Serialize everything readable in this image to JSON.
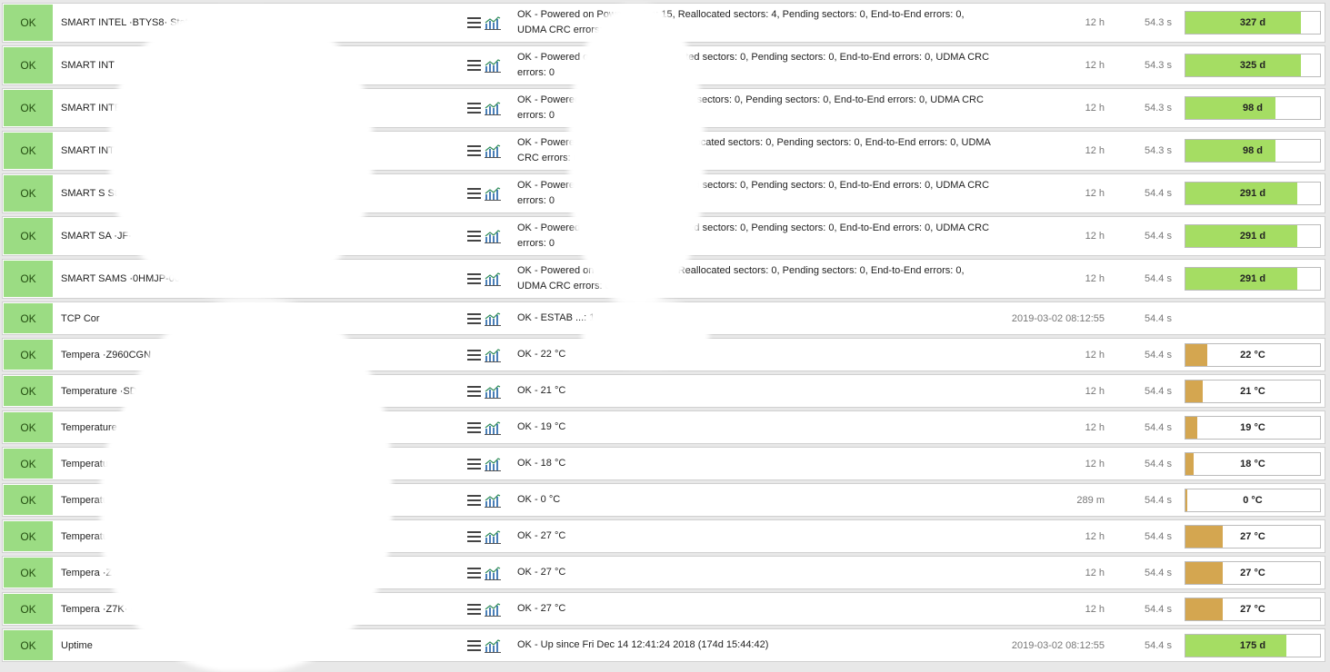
{
  "colors": {
    "ok": "#9bdc83",
    "perf_green": "#a5dd63",
    "perf_temp": "#d4a650"
  },
  "rows": [
    {
      "state": "OK",
      "service": "SMART INTEL ·BTYS8· Stats",
      "output": "OK - Powered on Power cycles: 15, Reallocated sectors: 4, Pending sectors: 0, End-to-End errors: 0, UDMA CRC errors: 0",
      "age": "12 h",
      "duration": "54.3 s",
      "perf": "327 d",
      "perf_pct": 0.86,
      "perf_kind": "green"
    },
    {
      "state": "OK",
      "service": "SMART INT",
      "output": "OK - Powered on cycles: 20, Reallocated sectors: 0, Pending sectors: 0, End-to-End errors: 0, UDMA CRC errors: 0",
      "age": "12 h",
      "duration": "54.3 s",
      "perf": "325 d",
      "perf_pct": 0.86,
      "perf_kind": "green"
    },
    {
      "state": "OK",
      "service": "SMART INTE Stats",
      "output": "OK - Powered on cycles: 4, Reallocated sectors: 0, Pending sectors: 0, End-to-End errors: 0, UDMA CRC errors: 0",
      "age": "12 h",
      "duration": "54.3 s",
      "perf": "98 d",
      "perf_pct": 0.67,
      "perf_kind": "green"
    },
    {
      "state": "OK",
      "service": "SMART INTE ·8_PHY· Stats",
      "output": "OK - Powered on Power cycles: 4, Reallocated sectors: 0, Pending sectors: 0, End-to-End errors: 0, UDMA CRC errors: 0",
      "age": "12 h",
      "duration": "54.3 s",
      "perf": "98 d",
      "perf_pct": 0.67,
      "perf_kind": "green"
    },
    {
      "state": "OK",
      "service": "SMART S Stats",
      "output": "OK - Powered on cycles: 55, Reallocated sectors: 0, Pending sectors: 0, End-to-End errors: 0, UDMA CRC errors: 0",
      "age": "12 h",
      "duration": "54.4 s",
      "perf": "291 d",
      "perf_pct": 0.83,
      "perf_kind": "green"
    },
    {
      "state": "OK",
      "service": "SMART SA ·JF· 74 Stats",
      "output": "OK - Powered on cycles: 55, Reallocated sectors: 0, Pending sectors: 0, End-to-End errors: 0, UDMA CRC errors: 0",
      "age": "12 h",
      "duration": "54.4 s",
      "perf": "291 d",
      "perf_pct": 0.83,
      "perf_kind": "green"
    },
    {
      "state": "OK",
      "service": "SMART SAMS ·0HMJP-00· 00976 Stats",
      "output": "OK - Powered on Power cycles: 55, Reallocated sectors: 0, Pending sectors: 0, End-to-End errors: 0, UDMA CRC errors: 0",
      "age": "12 h",
      "duration": "54.4 s",
      "perf": "291 d",
      "perf_pct": 0.83,
      "perf_kind": "green"
    },
    {
      "state": "OK",
      "service": "TCP Cor",
      "output": "OK - ESTAB ...: 1, LISTEN: 34",
      "age": "2019-03-02 08:12:55",
      "duration": "54.4 s",
      "perf": "",
      "perf_pct": 0,
      "perf_kind": "none"
    },
    {
      "state": "OK",
      "service": "Tempera ·Z960CGN",
      "output": "OK - 22 °C",
      "age": "12 h",
      "duration": "54.4 s",
      "perf": "22 °C",
      "perf_pct": 0.16,
      "perf_kind": "temp"
    },
    {
      "state": "OK",
      "service": "Temperature ·SDSC2KB· 60E1X960CGN",
      "output": "OK - 21 °C",
      "age": "12 h",
      "duration": "54.4 s",
      "perf": "21 °C",
      "perf_pct": 0.13,
      "perf_kind": "temp"
    },
    {
      "state": "OK",
      "service": "Temperature ·2KB9· 960CGN",
      "output": "OK - 19 °C",
      "age": "12 h",
      "duration": "54.4 s",
      "perf": "19 °C",
      "perf_pct": 0.09,
      "perf_kind": "temp"
    },
    {
      "state": "OK",
      "service": "Temperatur ·0CGN",
      "output": "OK - 18 °C",
      "age": "12 h",
      "duration": "54.4 s",
      "perf": "18 °C",
      "perf_pct": 0.06,
      "perf_kind": "temp"
    },
    {
      "state": "OK",
      "service": "Temperature ·ume_",
      "output": "OK - 0 °C",
      "age": "289 m",
      "duration": "54.4 s",
      "perf": "0 °C",
      "perf_pct": 0.01,
      "perf_kind": "temp"
    },
    {
      "state": "OK",
      "service": "Temperature ·G_MZ7KM960H· 2E3NX0K600972",
      "output": "OK - 27 °C",
      "age": "12 h",
      "duration": "54.4 s",
      "perf": "27 °C",
      "perf_pct": 0.28,
      "perf_kind": "temp"
    },
    {
      "state": "OK",
      "service": "Tempera ·Z7KM· 0K600974",
      "output": "OK - 27 °C",
      "age": "12 h",
      "duration": "54.4 s",
      "perf": "27 °C",
      "perf_pct": 0.28,
      "perf_kind": "temp"
    },
    {
      "state": "OK",
      "service": "Tempera ·Z7K· 0K600976",
      "output": "OK - 27 °C",
      "age": "12 h",
      "duration": "54.4 s",
      "perf": "27 °C",
      "perf_pct": 0.28,
      "perf_kind": "temp"
    },
    {
      "state": "OK",
      "service": "Uptime",
      "output": "OK - Up since Fri Dec 14 12:41:24 2018 (174d 15:44:42)",
      "age": "2019-03-02 08:12:55",
      "duration": "54.4 s",
      "perf": "175 d",
      "perf_pct": 0.75,
      "perf_kind": "green"
    }
  ]
}
